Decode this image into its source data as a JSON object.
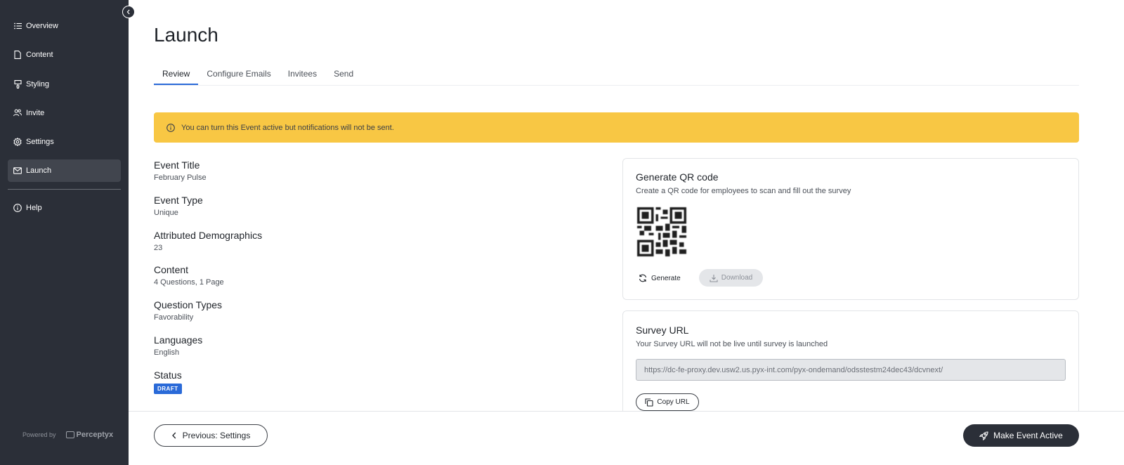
{
  "sidebar": {
    "items": [
      {
        "label": "Overview",
        "icon": "list-icon"
      },
      {
        "label": "Content",
        "icon": "document-icon"
      },
      {
        "label": "Styling",
        "icon": "paint-brush-icon"
      },
      {
        "label": "Invite",
        "icon": "users-icon"
      },
      {
        "label": "Settings",
        "icon": "gear-icon"
      },
      {
        "label": "Launch",
        "icon": "envelope-icon",
        "active": true
      },
      {
        "label": "Help",
        "icon": "info-icon"
      }
    ],
    "powered_by": "Powered by",
    "brand": "Perceptyx"
  },
  "page": {
    "title": "Launch"
  },
  "tabs": [
    {
      "label": "Review",
      "active": true
    },
    {
      "label": "Configure Emails"
    },
    {
      "label": "Invitees"
    },
    {
      "label": "Send"
    }
  ],
  "banner": {
    "text": "You can turn this Event active but notifications will not be sent.",
    "color": "#f8c744"
  },
  "details": [
    {
      "label": "Event Title",
      "value": "February Pulse"
    },
    {
      "label": "Event Type",
      "value": "Unique"
    },
    {
      "label": "Attributed Demographics",
      "value": "23"
    },
    {
      "label": "Content",
      "value": "4 Questions, 1 Page"
    },
    {
      "label": "Question Types",
      "value": "Favorability"
    },
    {
      "label": "Languages",
      "value": "English"
    },
    {
      "label": "Status",
      "value": "DRAFT"
    }
  ],
  "qr_card": {
    "title": "Generate QR code",
    "subtitle": "Create a QR code for employees to scan and fill out the survey",
    "generate_label": "Generate",
    "download_label": "Download"
  },
  "url_card": {
    "title": "Survey URL",
    "subtitle": "Your Survey URL will not be live until survey is launched",
    "url": "https://dc-fe-proxy.dev.usw2.us.pyx-int.com/pyx-ondemand/odsstestm24dec43/dcvnext/",
    "copy_label": "Copy URL"
  },
  "footer": {
    "previous_label": "Previous: Settings",
    "activate_label": "Make Event Active"
  },
  "colors": {
    "sidebar_bg": "#2b2f38",
    "accent": "#2a6ad8",
    "banner": "#f8c744"
  }
}
